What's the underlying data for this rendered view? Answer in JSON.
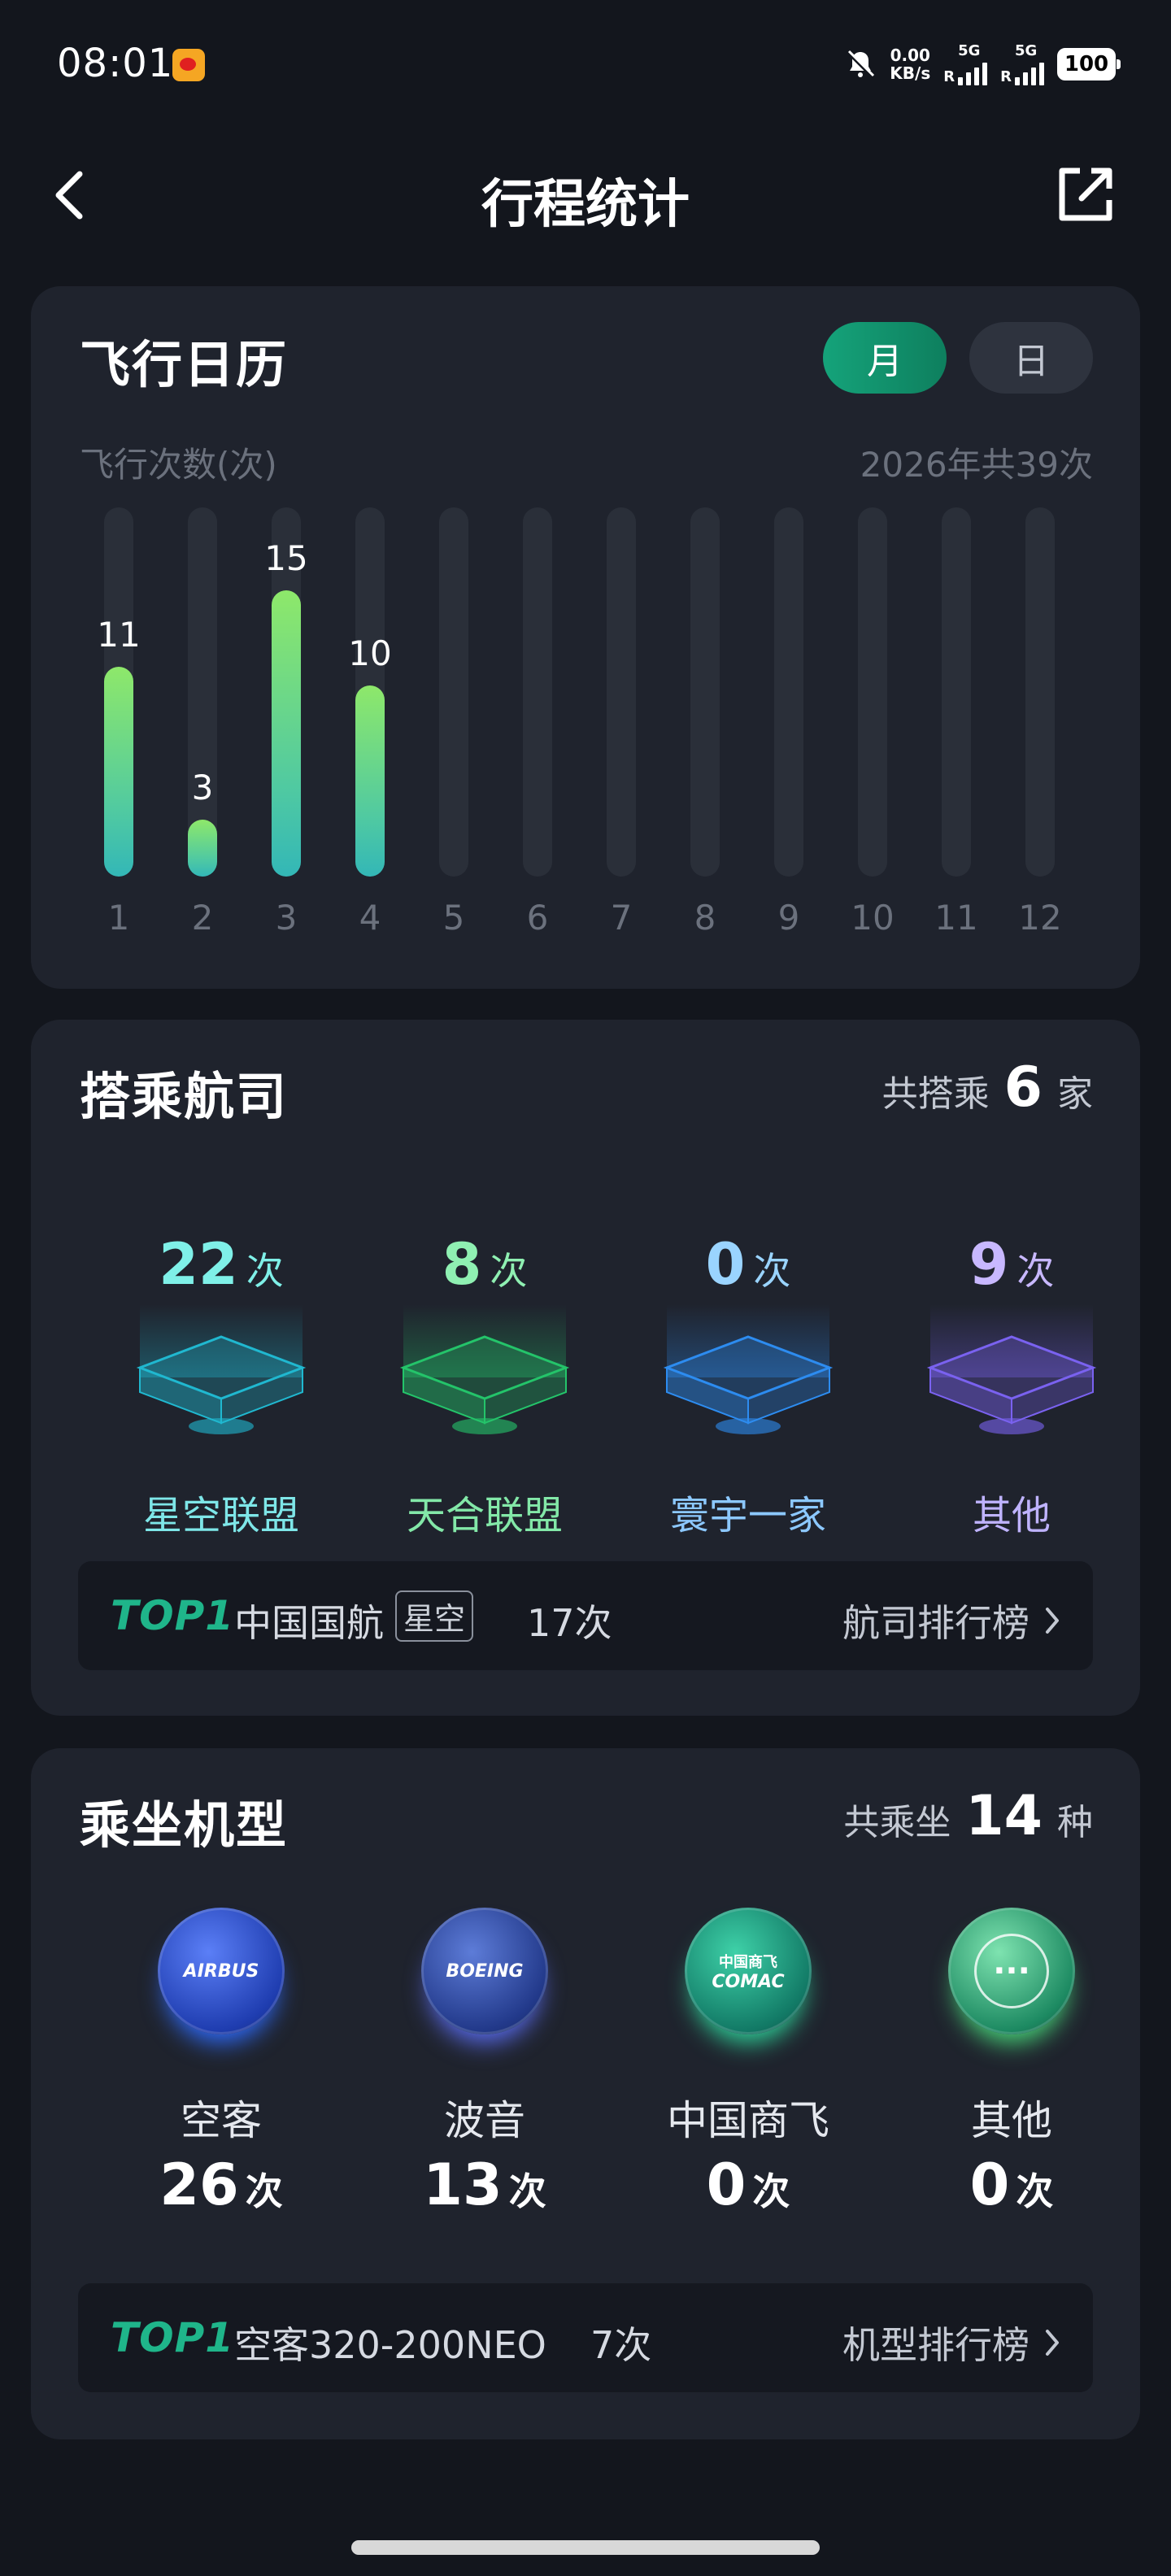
{
  "status_bar": {
    "time": "08:01",
    "speed_value": "0.00",
    "speed_unit": "KB/s",
    "net1": "5G",
    "net2": "5G",
    "roaming": "R",
    "battery": "100"
  },
  "header": {
    "title": "行程统计",
    "back_icon": "chevron-left-icon",
    "share_icon": "share-external-icon"
  },
  "flight_calendar": {
    "title": "飞行日历",
    "toggle_month": "月",
    "toggle_day": "日",
    "y_label": "飞行次数(次)",
    "summary": "2026年共39次"
  },
  "chart_data": {
    "type": "bar",
    "title": "",
    "xlabel": "",
    "ylabel": "飞行次数(次)",
    "categories": [
      "1",
      "2",
      "3",
      "4",
      "5",
      "6",
      "7",
      "8",
      "9",
      "10",
      "11",
      "12"
    ],
    "values": [
      11,
      3,
      15,
      10,
      null,
      null,
      null,
      null,
      null,
      null,
      null,
      null
    ],
    "ylim": [
      0,
      15
    ],
    "grid": false,
    "colors": {
      "bar_top": "#8ee86a",
      "bar_bottom": "#33b7b7",
      "track": "#2a2f39"
    }
  },
  "airlines": {
    "title": "搭乘航司",
    "summary_prefix": "共搭乘",
    "summary_count": "6",
    "summary_suffix": "家",
    "alliances": [
      {
        "count": "22",
        "unit": "次",
        "label": "星空联盟",
        "color": "#7ff0e8",
        "label_color": "#7ee6e8"
      },
      {
        "count": "8",
        "unit": "次",
        "label": "天合联盟",
        "color": "#8ff0b2",
        "label_color": "#83e8a8"
      },
      {
        "count": "0",
        "unit": "次",
        "label": "寰宇一家",
        "color": "#9ad4ff",
        "label_color": "#8cc8ff"
      },
      {
        "count": "9",
        "unit": "次",
        "label": "其他",
        "color": "#c8b8ff",
        "label_color": "#bfb3ff"
      }
    ],
    "top": {
      "badge": "TOP1",
      "name": "中国国航",
      "tag": "星空",
      "count": "17次",
      "link": "航司排行榜"
    }
  },
  "aircraft": {
    "title": "乘坐机型",
    "summary_prefix": "共乘坐",
    "summary_count": "14",
    "summary_suffix": "种",
    "types": [
      {
        "logo_text": "AIRBUS",
        "name": "空客",
        "count": "26",
        "unit": "次",
        "icon": "airbus-logo-icon"
      },
      {
        "logo_text": "BOEING",
        "name": "波音",
        "count": "13",
        "unit": "次",
        "icon": "boeing-logo-icon"
      },
      {
        "logo_text_cn": "中国商飞",
        "logo_text": "COMAC",
        "name": "中国商飞",
        "count": "0",
        "unit": "次",
        "icon": "comac-logo-icon"
      },
      {
        "logo_text": "···",
        "name": "其他",
        "count": "0",
        "unit": "次",
        "icon": "more-dots-icon"
      }
    ],
    "top": {
      "badge": "TOP1",
      "name": "空客320-200NEO",
      "count": "7次",
      "link": "机型排行榜"
    }
  }
}
